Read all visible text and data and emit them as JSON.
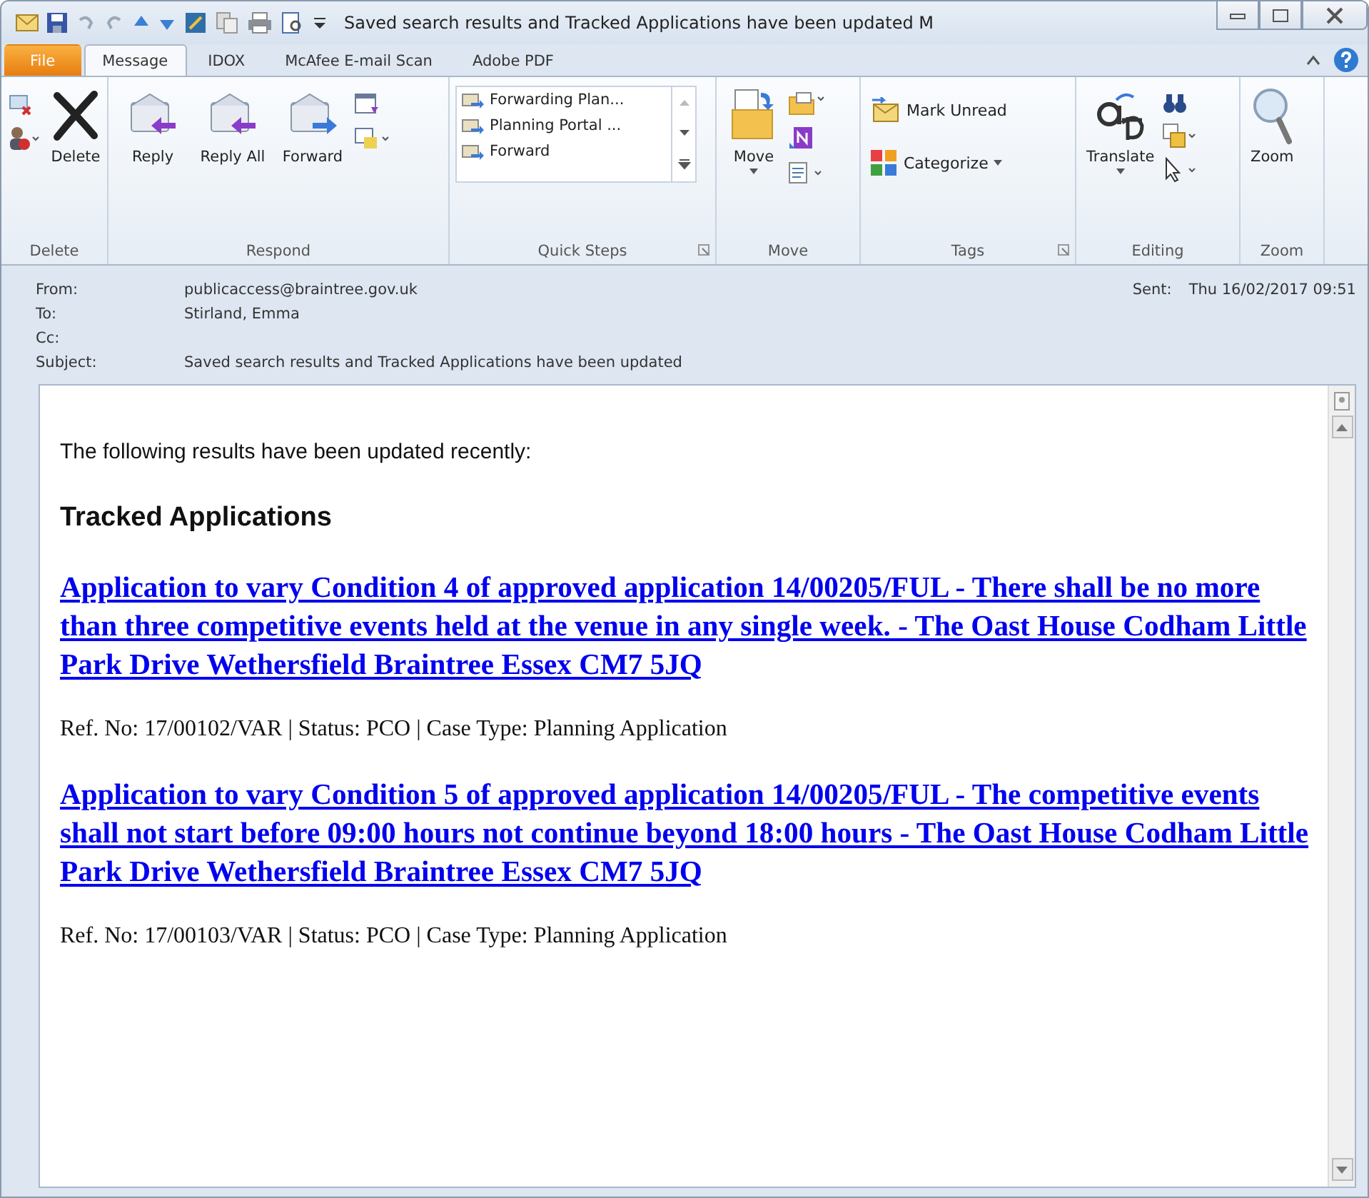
{
  "window": {
    "title": "Saved search results and Tracked Applications have been updated M"
  },
  "tabs": [
    {
      "label": "File",
      "kind": "file",
      "selected": false
    },
    {
      "label": "Message",
      "kind": "tab",
      "selected": true
    },
    {
      "label": "IDOX",
      "kind": "tab",
      "selected": false
    },
    {
      "label": "McAfee E-mail Scan",
      "kind": "tab",
      "selected": false
    },
    {
      "label": "Adobe PDF",
      "kind": "tab",
      "selected": false
    }
  ],
  "ribbon": {
    "delete": {
      "label": "Delete",
      "button": "Delete"
    },
    "respond": {
      "label": "Respond",
      "buttons": [
        "Reply",
        "Reply All",
        "Forward"
      ]
    },
    "quick_steps": {
      "label": "Quick Steps",
      "items": [
        "Forwarding Plan...",
        "Planning Portal ...",
        "Forward"
      ]
    },
    "move": {
      "label": "Move",
      "button": "Move"
    },
    "tags": {
      "label": "Tags",
      "buttons": [
        "Mark Unread",
        "Categorize"
      ]
    },
    "editing": {
      "label": "Editing",
      "button": "Translate"
    },
    "zoom": {
      "label": "Zoom",
      "button": "Zoom"
    }
  },
  "header": {
    "fields": [
      {
        "label": "From:",
        "value": "publicaccess@braintree.gov.uk"
      },
      {
        "label": "To:",
        "value": "Stirland, Emma"
      },
      {
        "label": "Cc:"
      },
      {
        "label": "Subject:",
        "value": "Saved search results and Tracked Applications have been updated"
      }
    ],
    "sent": {
      "label": "Sent:",
      "value": "Thu 16/02/2017 09:51"
    }
  },
  "body": {
    "intro": "The following results have been updated recently:",
    "heading": "Tracked Applications",
    "applications": [
      {
        "link": "Application to vary Condition 4 of approved application 14/00205/FUL - There shall be no more than three competitive events held at the venue in any single week. - The Oast House Codham Little Park Drive Wethersfield Braintree Essex CM7 5JQ",
        "details": "Ref. No: 17/00102/VAR | Status: PCO | Case Type: Planning Application"
      },
      {
        "link": "Application to vary Condition 5 of approved application 14/00205/FUL - The competitive events shall not start before 09:00 hours not continue beyond 18:00 hours - The Oast House Codham Little Park Drive Wethersfield Braintree Essex CM7 5JQ",
        "details": "Ref. No: 17/00103/VAR | Status: PCO | Case Type: Planning Application"
      }
    ]
  }
}
